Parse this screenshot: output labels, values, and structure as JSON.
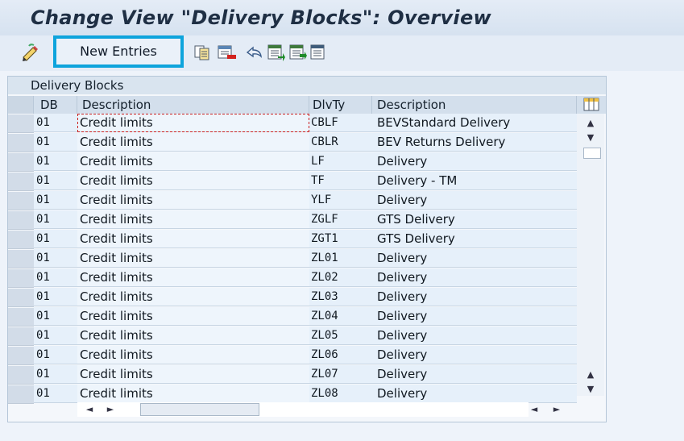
{
  "window": {
    "title": "Change View \"Delivery Blocks\": Overview"
  },
  "toolbar": {
    "new_entries_label": "New Entries"
  },
  "table": {
    "title": "Delivery Blocks",
    "columns": [
      "DB",
      "Description",
      "DlvTy",
      "Description"
    ],
    "rows": [
      {
        "db": "01",
        "desc": "Credit limits",
        "dlvty": "CBLF",
        "dlvdesc": "BEVStandard Delivery"
      },
      {
        "db": "01",
        "desc": "Credit limits",
        "dlvty": "CBLR",
        "dlvdesc": "BEV Returns Delivery"
      },
      {
        "db": "01",
        "desc": "Credit limits",
        "dlvty": "LF",
        "dlvdesc": "Delivery"
      },
      {
        "db": "01",
        "desc": "Credit limits",
        "dlvty": "TF",
        "dlvdesc": "Delivery - TM"
      },
      {
        "db": "01",
        "desc": "Credit limits",
        "dlvty": "YLF",
        "dlvdesc": "Delivery"
      },
      {
        "db": "01",
        "desc": "Credit limits",
        "dlvty": "ZGLF",
        "dlvdesc": "GTS Delivery"
      },
      {
        "db": "01",
        "desc": "Credit limits",
        "dlvty": "ZGT1",
        "dlvdesc": "GTS Delivery"
      },
      {
        "db": "01",
        "desc": "Credit limits",
        "dlvty": "ZL01",
        "dlvdesc": "Delivery"
      },
      {
        "db": "01",
        "desc": "Credit limits",
        "dlvty": "ZL02",
        "dlvdesc": "Delivery"
      },
      {
        "db": "01",
        "desc": "Credit limits",
        "dlvty": "ZL03",
        "dlvdesc": "Delivery"
      },
      {
        "db": "01",
        "desc": "Credit limits",
        "dlvty": "ZL04",
        "dlvdesc": "Delivery"
      },
      {
        "db": "01",
        "desc": "Credit limits",
        "dlvty": "ZL05",
        "dlvdesc": "Delivery"
      },
      {
        "db": "01",
        "desc": "Credit limits",
        "dlvty": "ZL06",
        "dlvdesc": "Delivery"
      },
      {
        "db": "01",
        "desc": "Credit limits",
        "dlvty": "ZL07",
        "dlvdesc": "Delivery"
      },
      {
        "db": "01",
        "desc": "Credit limits",
        "dlvty": "ZL08",
        "dlvdesc": "Delivery"
      }
    ]
  },
  "icons": [
    "pencil-icon",
    "copy-icon",
    "delete-icon",
    "undo-icon",
    "select-all-icon",
    "select-block-icon",
    "deselect-all-icon",
    "column-config-icon"
  ],
  "colors": {
    "highlight": "#0ea4dc",
    "panel_header": "#d9e4ef",
    "cell_bg": "#e6f0fa"
  }
}
